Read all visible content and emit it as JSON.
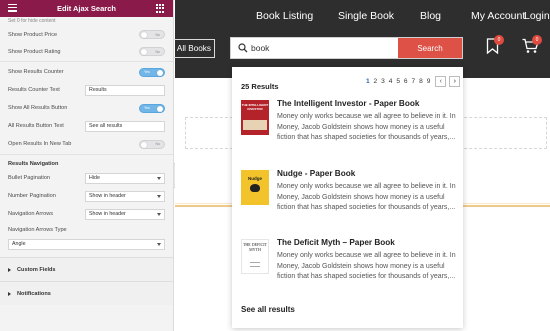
{
  "panel": {
    "title": "Edit Ajax Search",
    "note": "Set 0 for hide content",
    "rows": [
      {
        "label": "Show Product Price",
        "toggle": "No"
      },
      {
        "label": "Show Product Rating",
        "toggle": "No"
      },
      {
        "label": "Show Results Counter",
        "toggle": "Yes"
      },
      {
        "label": "Results Counter Text",
        "value": "Results"
      },
      {
        "label": "Show All Results Button",
        "toggle": "Yes"
      },
      {
        "label": "All Results Button Text",
        "value": "See all results"
      },
      {
        "label": "Open Results In New Tab",
        "toggle": "No"
      }
    ],
    "nav_section": {
      "title": "Results Navigation",
      "bullet_label": "Bullet Pagination",
      "bullet_value": "Hide",
      "number_label": "Number Pagination",
      "number_value": "Show in header",
      "arrows_label": "Navigation Arrows",
      "arrows_value": "Show in header",
      "arrows_type_label": "Navigation Arrows Type",
      "arrows_type_value": "Angle"
    },
    "accordions": [
      "Custom Fields",
      "Notifications"
    ]
  },
  "site": {
    "nav": [
      "Book Listing",
      "Single Book",
      "Blog",
      "My Account",
      "Login"
    ],
    "categories_label": "All Books",
    "search_value": "book",
    "search_button": "Search",
    "wishlist_count": "0",
    "cart_count": "0"
  },
  "results": {
    "count_text": "25 Results",
    "pages": [
      "1",
      "2",
      "3",
      "4",
      "5",
      "6",
      "7",
      "8",
      "9"
    ],
    "active_page": "1",
    "items": [
      {
        "title": "The Intelligent Investor - Paper Book",
        "description": "Money only works because we all agree to believe in it. In Money, Jacob Goldstein shows how money is a useful fiction that has shaped societies for thousands of years,...",
        "cover_text": "THE INTELLIGENT INVESTOR"
      },
      {
        "title": "Nudge - Paper Book",
        "description": "Money only works because we all agree to believe in it. In Money, Jacob Goldstein shows how money is a useful fiction that has shaped societies for thousands of years,...",
        "cover_text": "Nudge"
      },
      {
        "title": "The Deficit Myth – Paper Book",
        "description": "Money only works because we all agree to believe in it. In Money, Jacob Goldstein shows how money is a useful fiction that has shaped societies for thousands of years,...",
        "cover_text": "THE DEFICIT MYTH"
      }
    ],
    "see_all": "See all results"
  },
  "colors": {
    "panel_header": "#8a1a4a",
    "toggle_on": "#72b6e8",
    "site_topbar": "#2e2e2e",
    "search_button": "#dd5146",
    "active_page": "#2566b9"
  }
}
